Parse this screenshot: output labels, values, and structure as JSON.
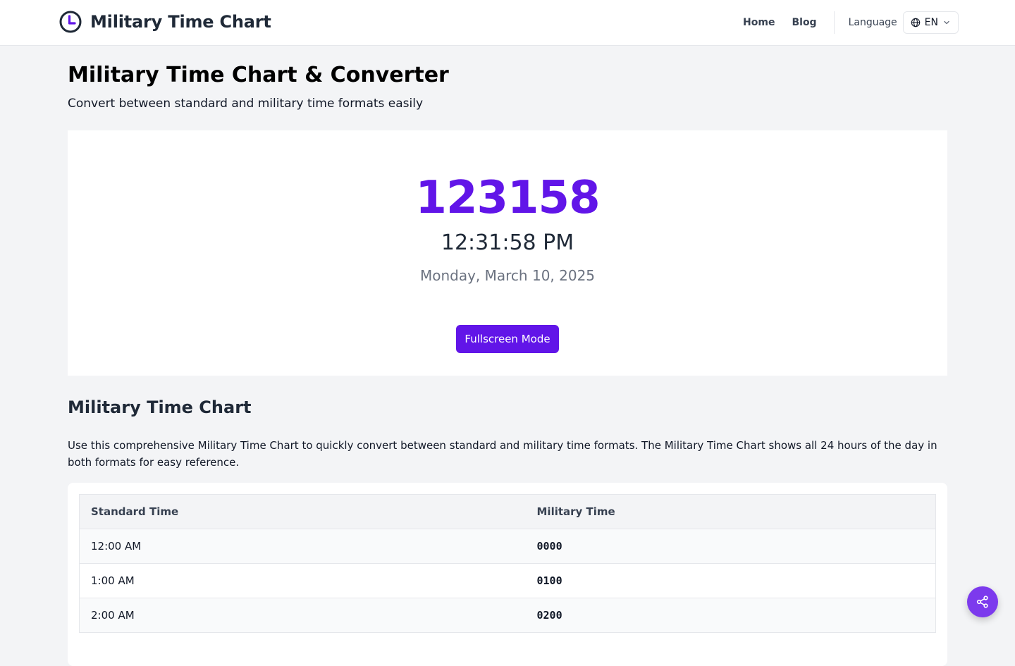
{
  "header": {
    "logo_text": "Military Time Chart",
    "logo_icon": "clock-icon",
    "nav": [
      {
        "label": "Home"
      },
      {
        "label": "Blog"
      }
    ],
    "language_label": "Language",
    "language_value": "EN",
    "language_icon": "globe-icon"
  },
  "page": {
    "title": "Military Time Chart & Converter",
    "subtitle": "Convert between standard and military time formats easily"
  },
  "clock": {
    "military": "123158",
    "standard": "12:31:58 PM",
    "date": "Monday, March 10, 2025",
    "fullscreen_label": "Fullscreen Mode"
  },
  "chart_section": {
    "title": "Military Time Chart",
    "description": "Use this comprehensive Military Time Chart to quickly convert between standard and military time formats. The Military Time Chart shows all 24 hours of the day in both formats for easy reference.",
    "columns": [
      "Standard Time",
      "Military Time"
    ],
    "rows": [
      {
        "standard": "12:00 AM",
        "military": "0000"
      },
      {
        "standard": "1:00 AM",
        "military": "0100"
      },
      {
        "standard": "2:00 AM",
        "military": "0200"
      }
    ]
  },
  "share_icon": "share-icon",
  "colors": {
    "accent": "#6115e8",
    "share_button": "#7c3aed",
    "background": "#f3f4f6"
  }
}
